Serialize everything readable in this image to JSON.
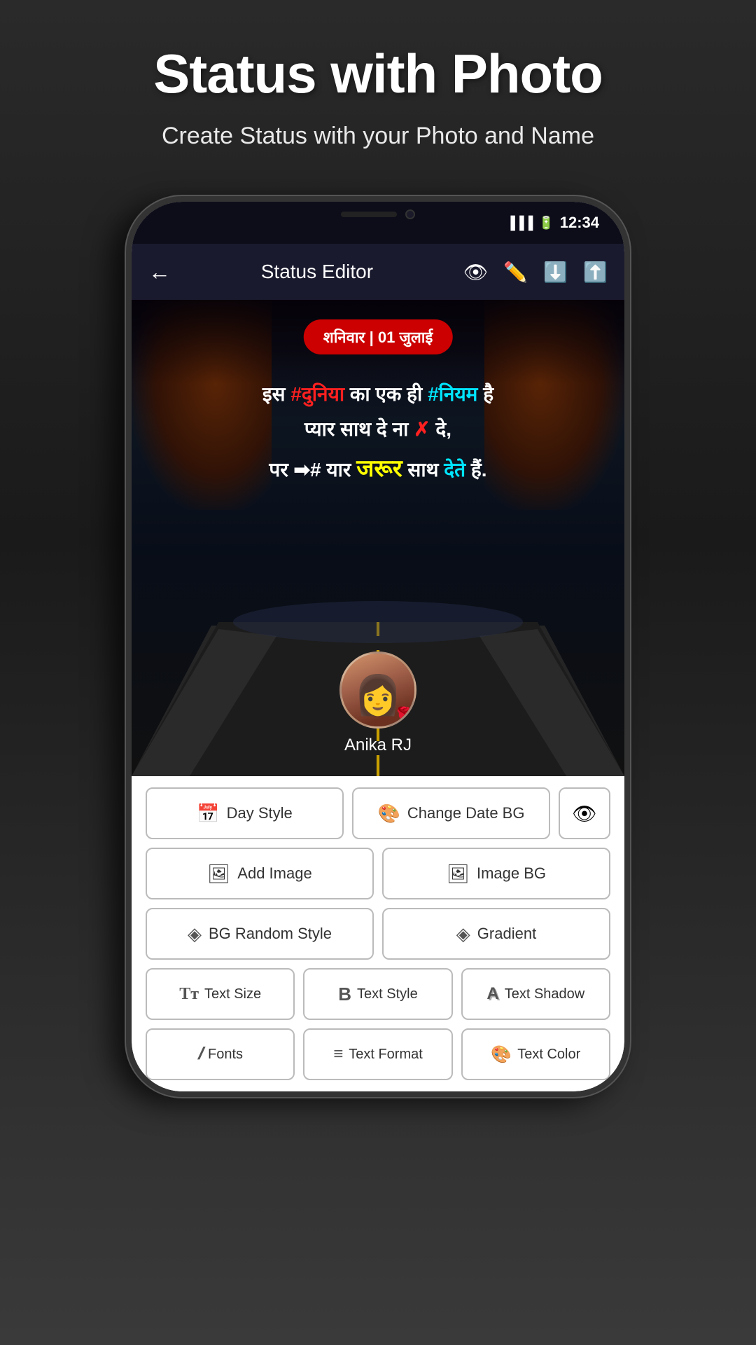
{
  "header": {
    "title": "Status with Photo",
    "subtitle": "Create Status with your Photo and Name"
  },
  "statusBar": {
    "time": "12:34",
    "batteryIcon": "🔋",
    "signalIcon": "📶"
  },
  "appBar": {
    "title": "Status Editor",
    "backIcon": "←",
    "eyeIcon": "👁",
    "penIcon": "✏",
    "downloadIcon": "⬇",
    "shareIcon": "⬆"
  },
  "canvas": {
    "dateBadge": "शनिवार | 01 जुलाई",
    "quoteLine1": "इस #दुनिया का एक ही #नियम है",
    "quoteLine2": "प्यार साथ दे ना ✗ दे,",
    "quoteLine3": "पर ➡# यार जरूर साथ देते हैं.",
    "profileName": "Anika RJ"
  },
  "controls": {
    "row1": [
      {
        "icon": "📅",
        "label": "Day Style"
      },
      {
        "icon": "🎨",
        "label": "Change Date BG"
      },
      {
        "icon": "👁",
        "label": ""
      }
    ],
    "row2": [
      {
        "icon": "🖼",
        "label": "Add Image"
      },
      {
        "icon": "🖼",
        "label": "Image BG"
      }
    ],
    "row3": [
      {
        "icon": "◈",
        "label": "BG Random Style"
      },
      {
        "icon": "◈",
        "label": "Gradient"
      }
    ],
    "row4": [
      {
        "icon": "Tт",
        "label": "Text Size"
      },
      {
        "icon": "B",
        "label": "Text Style"
      },
      {
        "icon": "A",
        "label": "Text Shadow"
      }
    ],
    "row5": [
      {
        "icon": "𝐼",
        "label": "Fonts"
      },
      {
        "icon": "≡",
        "label": "Text Format"
      },
      {
        "icon": "🎨",
        "label": "Text Color"
      }
    ]
  }
}
